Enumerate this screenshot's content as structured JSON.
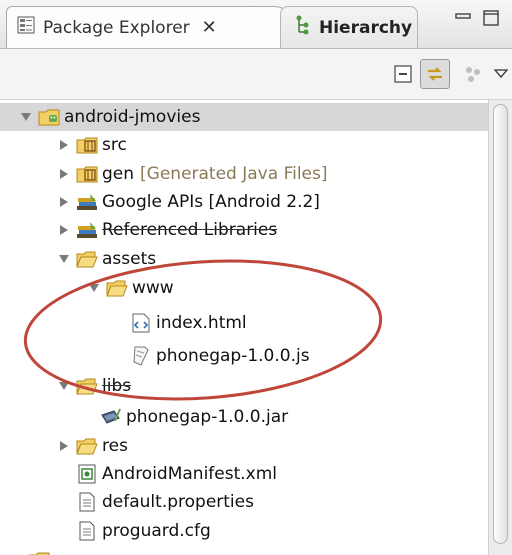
{
  "tabs": {
    "active": {
      "label": "Package Explorer",
      "close_glyph": "✕"
    },
    "inactive": {
      "label": "Hierarchy"
    }
  },
  "tree": [
    {
      "label": "android-jmovies",
      "icon": "android-project-icon",
      "expanded": true
    },
    {
      "label": "src",
      "icon": "source-folder-icon",
      "expanded": false
    },
    {
      "label": "gen",
      "sublabel": "[Generated Java Files]",
      "icon": "gen-folder-icon",
      "expanded": false
    },
    {
      "label": "Google APIs [Android 2.2]",
      "icon": "library-icon",
      "expanded": false
    },
    {
      "label": "Referenced Libraries",
      "icon": "library-icon",
      "expanded": false
    },
    {
      "label": "assets",
      "icon": "folder-icon",
      "expanded": true
    },
    {
      "label": "www",
      "icon": "folder-icon",
      "expanded": true
    },
    {
      "label": "index.html",
      "icon": "html-file-icon"
    },
    {
      "label": "phonegap-1.0.0.js",
      "icon": "js-file-icon"
    },
    {
      "label": "libs",
      "icon": "folder-icon",
      "expanded": true
    },
    {
      "label": "phonegap-1.0.0.jar",
      "icon": "jar-icon"
    },
    {
      "label": "res",
      "icon": "folder-icon",
      "expanded": false
    },
    {
      "label": "AndroidManifest.xml",
      "icon": "manifest-file-icon"
    },
    {
      "label": "default.properties",
      "icon": "text-file-icon"
    },
    {
      "label": "proguard.cfg",
      "icon": "text-file-icon"
    }
  ],
  "colors": {
    "selection": "#d7d7d7",
    "annotation_circle": "#c0463a",
    "decoration_text": "#8a7a56"
  }
}
